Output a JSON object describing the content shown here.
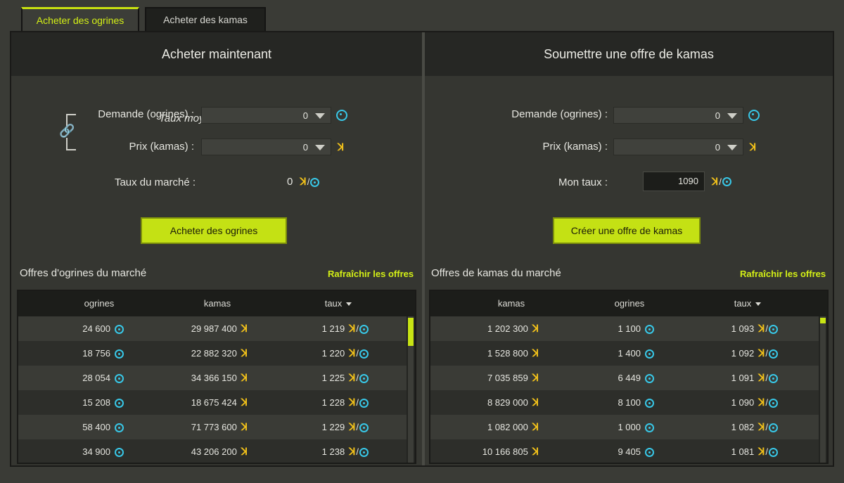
{
  "tabs": {
    "buy_ogrines": "Acheter des ogrines",
    "buy_kamas": "Acheter des kamas"
  },
  "left": {
    "title": "Acheter maintenant",
    "avg_rate": "Taux moyen : 1090",
    "demand_label": "Demande (ogrines) :",
    "demand_value": "0",
    "price_label": "Prix (kamas) :",
    "price_value": "0",
    "market_rate_label": "Taux du marché :",
    "market_rate_value": "0",
    "button": "Acheter des ogrines",
    "list_title": "Offres d'ogrines du marché",
    "refresh": "Rafraîchir les offres",
    "columns": [
      "ogrines",
      "kamas",
      "taux"
    ],
    "rows": [
      {
        "a": "24 600",
        "b": "29 987 400",
        "c": "1 219"
      },
      {
        "a": "18 756",
        "b": "22 882 320",
        "c": "1 220"
      },
      {
        "a": "28 054",
        "b": "34 366 150",
        "c": "1 225"
      },
      {
        "a": "15 208",
        "b": "18 675 424",
        "c": "1 228"
      },
      {
        "a": "58 400",
        "b": "71 773 600",
        "c": "1 229"
      },
      {
        "a": "34 900",
        "b": "43 206 200",
        "c": "1 238"
      }
    ]
  },
  "right": {
    "title": "Soumettre une offre de kamas",
    "demand_label": "Demande (ogrines) :",
    "demand_value": "0",
    "price_label": "Prix (kamas) :",
    "price_value": "0",
    "my_rate_label": "Mon taux :",
    "my_rate_value": "1090",
    "button": "Créer une offre de kamas",
    "list_title": "Offres de kamas du marché",
    "refresh": "Rafraîchir les offres",
    "columns": [
      "kamas",
      "ogrines",
      "taux"
    ],
    "rows": [
      {
        "a": "1 202 300",
        "b": "1 100",
        "c": "1 093"
      },
      {
        "a": "1 528 800",
        "b": "1 400",
        "c": "1 092"
      },
      {
        "a": "7 035 859",
        "b": "6 449",
        "c": "1 091"
      },
      {
        "a": "8 829 000",
        "b": "8 100",
        "c": "1 090"
      },
      {
        "a": "1 082 000",
        "b": "1 000",
        "c": "1 082"
      },
      {
        "a": "10 166 805",
        "b": "9 405",
        "c": "1 081"
      }
    ]
  },
  "icons": {
    "kamas": "kamas-icon",
    "ogrines": "ogrines-icon",
    "link": "link-icon"
  },
  "colors": {
    "accent": "#c4e114",
    "accent_text": "#d4f016",
    "kamas": "#f3c21a",
    "ogrines": "#38c8e8"
  }
}
